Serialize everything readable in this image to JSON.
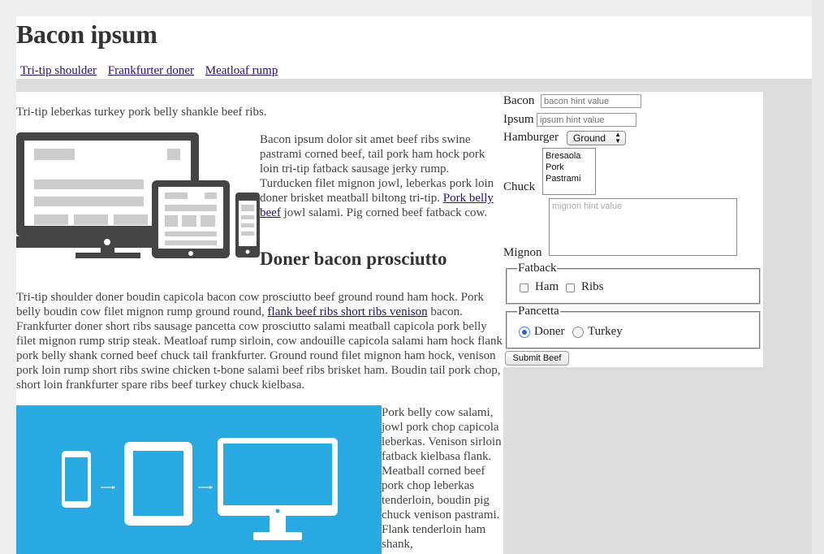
{
  "header": {
    "title": "Bacon ipsum",
    "nav": [
      "Tri-tip shoulder",
      "Frankfurter doner",
      "Meatloaf rump"
    ]
  },
  "main": {
    "intro": "Tri-tip leberkas turkey pork belly shankle beef ribs.",
    "float_text_before": "Bacon ipsum dolor sit amet beef ribs swine pastrami corned beef, tail pork ham hock pork loin tri-tip fatback sausage jerky rump. Turducken filet mignon jowl, leberkas pork loin doner brisket meatball biltong tri-tip. ",
    "float_link": "Pork belly beef",
    "float_text_after": " jowl salami. Pig corned beef fatback cow.",
    "heading": "Doner bacon prosciutto",
    "para2_before": "Tri-tip shoulder doner boudin capicola bacon cow prosciutto beef ground round ham hock. Pork belly boudin cow filet mignon rump ground round, ",
    "para2_link": "flank beef ribs short ribs venison",
    "para2_after": " bacon. Frankfurter doner short ribs sausage pancetta cow prosciutto salami meatball capicola pork belly filet mignon rump strip steak. Meatloaf rump sirloin, cow andouille capicola salami ham hock flank pork belly shank corned beef chuck tail frankfurter. Ground round filet mignon ham hock, venison pork loin rump short ribs swine chicken t-bone salami beef ribs brisket ham. Boudin tail pork chop, short loin frankfurter spare ribs beef turkey chuck kielbasa.",
    "side_text": "Pork belly cow salami, jowl pork chop capicola leberkas. Venison sirloin fatback kielbasa flank. Meatball corned beef pork chop leberkas tenderloin, boudin pig chuck venison pastrami. Flank tenderloin ham shank,"
  },
  "form": {
    "bacon_label": "Bacon",
    "bacon_placeholder": "bacon hint value",
    "ipsum_label": "Ipsum",
    "ipsum_placeholder": "ipsum hint value",
    "hamburger_label": "Hamburger",
    "hamburger_selected": "Ground",
    "chuck_label": "Chuck",
    "chuck_options": [
      "Bresaola",
      "Pork",
      "Pastrami"
    ],
    "mignon_label": "Mignon",
    "mignon_placeholder": "mignon hint value",
    "fatback_legend": "Fatback",
    "fatback_options": [
      "Ham",
      "Ribs"
    ],
    "pancetta_legend": "Pancetta",
    "pancetta_options": [
      "Doner",
      "Turkey"
    ],
    "pancetta_selected": "Doner",
    "submit_label": "Submit Beef"
  },
  "colors": {
    "link": "#2a0e6e",
    "image_blue": "#29a9e1",
    "device_dark": "#444444"
  }
}
